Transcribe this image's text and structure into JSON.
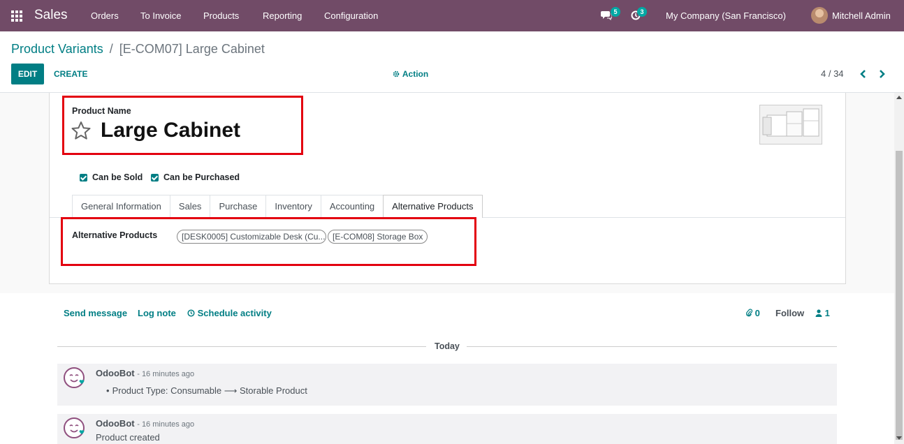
{
  "navbar": {
    "app_name": "Sales",
    "menu": [
      "Orders",
      "To Invoice",
      "Products",
      "Reporting",
      "Configuration"
    ],
    "messages_count": "5",
    "activities_count": "3",
    "company": "My Company (San Francisco)",
    "user": "Mitchell Admin",
    "background": "#714b67"
  },
  "control": {
    "breadcrumb_parent": "Product Variants",
    "breadcrumb_separator": "/",
    "breadcrumb_current": "[E-COM07] Large Cabinet",
    "edit_label": "EDIT",
    "create_label": "CREATE",
    "action_label": "Action",
    "pager": "4 / 34"
  },
  "form": {
    "name_label": "Product Name",
    "product_name": "Large Cabinet",
    "can_be_sold": "Can be Sold",
    "can_be_purchased": "Can be Purchased",
    "tabs": [
      "General Information",
      "Sales",
      "Purchase",
      "Inventory",
      "Accounting",
      "Alternative Products"
    ],
    "active_tab": "Alternative Products",
    "alt_products_label": "Alternative Products",
    "alt_products": [
      "[DESK0005] Customizable Desk (Cu...",
      "[E-COM08] Storage Box"
    ]
  },
  "chatter": {
    "send_message": "Send message",
    "log_note": "Log note",
    "schedule_activity": "Schedule activity",
    "attachments": "0",
    "follow": "Follow",
    "followers": "1",
    "separator": "Today",
    "messages": [
      {
        "author": "OdooBot",
        "time": "- 16 minutes ago",
        "body": "Product Type: Consumable ⟶ Storable Product"
      },
      {
        "author": "OdooBot",
        "time": "- 16 minutes ago",
        "body": "Product created"
      }
    ]
  },
  "colors": {
    "accent": "#017e84",
    "highlight": "#e3000f",
    "badge": "#01a8a4"
  }
}
